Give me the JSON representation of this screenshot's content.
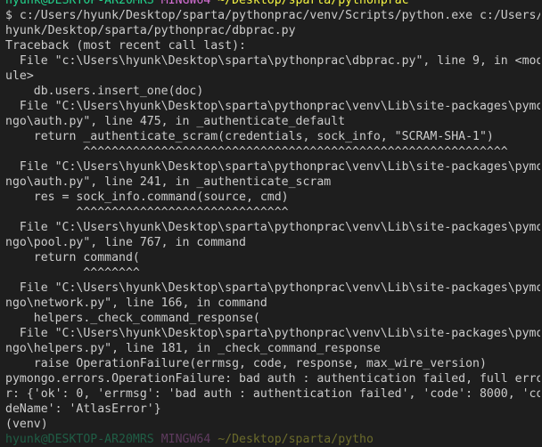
{
  "terminal": {
    "lines": [
      {
        "kind": "prompt",
        "user": "hyunk@DESKTOP-AR20MRS",
        "shell": "MINGW64",
        "cwd": "~/Desktop/sparta/pythonprac"
      },
      {
        "kind": "text",
        "text": "$ c:/Users/hyunk/Desktop/sparta/pythonprac/venv/Scripts/python.exe c:/Users/"
      },
      {
        "kind": "text",
        "text": "hyunk/Desktop/sparta/pythonprac/dbprac.py"
      },
      {
        "kind": "text",
        "text": "Traceback (most recent call last):"
      },
      {
        "kind": "text",
        "text": "  File \"c:\\Users\\hyunk\\Desktop\\sparta\\pythonprac\\dbprac.py\", line 9, in <mod"
      },
      {
        "kind": "text",
        "text": "ule>"
      },
      {
        "kind": "text",
        "text": "    db.users.insert_one(doc)"
      },
      {
        "kind": "text",
        "text": "  File \"C:\\Users\\hyunk\\Desktop\\sparta\\pythonprac\\venv\\Lib\\site-packages\\pymo"
      },
      {
        "kind": "text",
        "text": "ngo\\auth.py\", line 475, in _authenticate_default"
      },
      {
        "kind": "text",
        "text": "    return _authenticate_scram(credentials, sock_info, \"SCRAM-SHA-1\")"
      },
      {
        "kind": "text",
        "text": "           ^^^^^^^^^^^^^^^^^^^^^^^^^^^^^^^^^^^^^^^^^^^^^^^^^^^^^^^^^^^^"
      },
      {
        "kind": "text",
        "text": "  File \"C:\\Users\\hyunk\\Desktop\\sparta\\pythonprac\\venv\\Lib\\site-packages\\pymo"
      },
      {
        "kind": "text",
        "text": "ngo\\auth.py\", line 241, in _authenticate_scram"
      },
      {
        "kind": "text",
        "text": "    res = sock_info.command(source, cmd)"
      },
      {
        "kind": "text",
        "text": "          ^^^^^^^^^^^^^^^^^^^^^^^^^^^^^^"
      },
      {
        "kind": "text",
        "text": "  File \"C:\\Users\\hyunk\\Desktop\\sparta\\pythonprac\\venv\\Lib\\site-packages\\pymo"
      },
      {
        "kind": "text",
        "text": "ngo\\pool.py\", line 767, in command"
      },
      {
        "kind": "text",
        "text": "    return command("
      },
      {
        "kind": "text",
        "text": "           ^^^^^^^^"
      },
      {
        "kind": "text",
        "text": "  File \"C:\\Users\\hyunk\\Desktop\\sparta\\pythonprac\\venv\\Lib\\site-packages\\pymo"
      },
      {
        "kind": "text",
        "text": "ngo\\network.py\", line 166, in command"
      },
      {
        "kind": "text",
        "text": "    helpers._check_command_response("
      },
      {
        "kind": "text",
        "text": "  File \"C:\\Users\\hyunk\\Desktop\\sparta\\pythonprac\\venv\\Lib\\site-packages\\pymo"
      },
      {
        "kind": "text",
        "text": "ngo\\helpers.py\", line 181, in _check_command_response"
      },
      {
        "kind": "text",
        "text": "    raise OperationFailure(errmsg, code, response, max_wire_version)"
      },
      {
        "kind": "text",
        "text": "pymongo.errors.OperationFailure: bad auth : authentication failed, full erro"
      },
      {
        "kind": "text",
        "text": "r: {'ok': 0, 'errmsg': 'bad auth : authentication failed', 'code': 8000, 'co"
      },
      {
        "kind": "text",
        "text": "deName': 'AtlasError'}"
      },
      {
        "kind": "text",
        "text": "(venv)"
      },
      {
        "kind": "prompt",
        "user": "hyunk@DESKTOP-AR20MRS",
        "shell": "MINGW64",
        "cwd": "~/Desktop/sparta/pytho",
        "dim": true
      }
    ]
  }
}
